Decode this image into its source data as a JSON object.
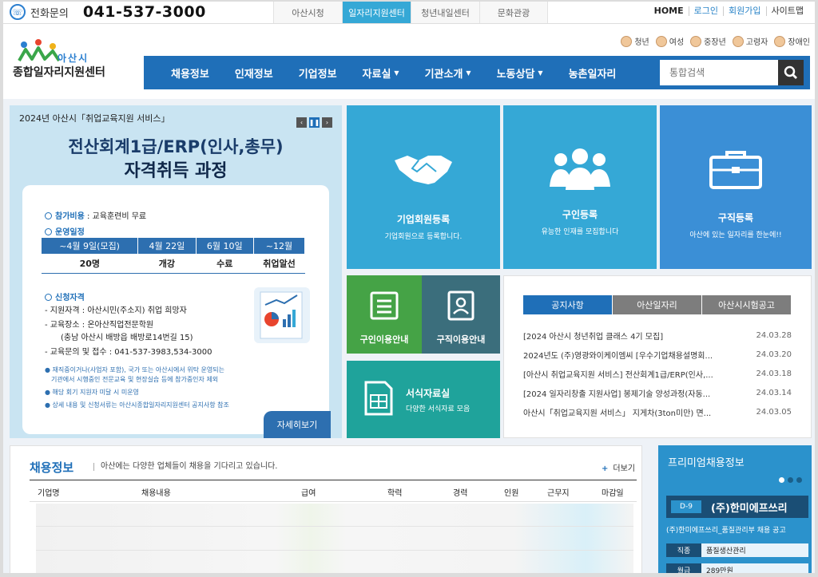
{
  "topbar": {
    "phone_label": "전화문의",
    "phone_number": "041-537-3000",
    "tabs": [
      "아산시청",
      "일자리지원센터",
      "청년내일센터",
      "문화관광"
    ],
    "links": [
      "HOME",
      "로그인",
      "회원가입",
      "사이트맵"
    ]
  },
  "header": {
    "logo_city": "아산시",
    "logo_title": "종합일자리지원센터",
    "user_types": [
      "청년",
      "여성",
      "중장년",
      "고령자",
      "장애인"
    ],
    "nav": [
      "채용정보",
      "인재정보",
      "기업정보",
      "자료실",
      "기관소개",
      "노동상담",
      "농촌일자리"
    ],
    "search_placeholder": "통합검색"
  },
  "banner": {
    "top": "2024년 아산시「취업교육지원 서비스」",
    "title1": "전산회계1급/ERP(인사,총무)",
    "title2": "자격취득 과정",
    "fee": "참가비용 : 교육훈련비 무료",
    "fee_label": "참가비용",
    "fee_value": "교육훈련비 무료",
    "schedule_heading": "운영일정",
    "schedule": {
      "headers": [
        "~4월 9일(모집)",
        "4월 22일",
        "6월 10일",
        "~12월"
      ],
      "values": [
        "20명",
        "개강",
        "수료",
        "취업알선"
      ]
    },
    "apply_heading": "신청자격",
    "apply_lines": [
      "- 지원자격 : 아산시민(주소지) 취업 희망자",
      "- 교육장소 : 온아산직업전문학원",
      "(충남 아산시 배방읍 배방로14번길 15)",
      "- 교육문의 및 접수 : 041-537-3983,534-3000"
    ],
    "notes": [
      "● 재직중이거나(사업자 포함), 국가 또는 아산시에서 위탁 운영되는",
      "기관에서 시행중인 전문교육 및 현장실습 등에 참가중인자 제외",
      "● 해당 회기 지원자 미달 시 미운영",
      "● 상세 내용 및 신청서류는 아산시종합일자리지원센터 공지사항 참조"
    ],
    "more": "자세히보기"
  },
  "tiles": {
    "t1": {
      "title": "기업회원등록",
      "sub": "기업회원으로 등록합니다."
    },
    "t2": {
      "title": "구인등록",
      "sub": "유능한 인재를 모집합니다"
    },
    "t3": {
      "title": "구직등록",
      "sub": "아산에 있는 일자리를 한눈에!!"
    },
    "t4": {
      "title": "구인이용안내"
    },
    "t5": {
      "title": "구직이용안내"
    },
    "t6": {
      "title": "서식자료실",
      "sub": "다양한 서식자료 모음"
    }
  },
  "notice": {
    "tabs": [
      "공지사항",
      "아산일자리",
      "아산시시험공고"
    ],
    "items": [
      {
        "title": "[2024 아산시 청년취업 클래스 4기 모집]",
        "date": "24.03.28"
      },
      {
        "title": "2024년도 (주)영광와이케이엠씨 [우수기업채용설명회...",
        "date": "24.03.20"
      },
      {
        "title": "[아산시 취업교육지원 서비스] 전산회계1급/ERP(인사,...",
        "date": "24.03.18"
      },
      {
        "title": "[2024 일자리창출 지원사업] 봉제기술 양성과정(자동...",
        "date": "24.03.14"
      },
      {
        "title": "아산시「취업교육지원 서비스」 지게차(3ton미만) 면...",
        "date": "24.03.05"
      }
    ]
  },
  "jobs": {
    "title": "채용정보",
    "desc": "아산에는 다양한 업체들이 채용을 기다리고 있습니다.",
    "more": "더보기",
    "columns": [
      "기업명",
      "채용내용",
      "급여",
      "학력",
      "경력",
      "인원",
      "근무지",
      "마감일"
    ]
  },
  "premium": {
    "title": "프리미엄채용정보",
    "dday": "D-9",
    "company": "(주)한미에프쓰리",
    "desc": "(주)한미에프쓰리_품질관리부 채용 공고",
    "fields": [
      {
        "k": "직종",
        "v": "품질생산관리"
      },
      {
        "k": "월급",
        "v": "289만원"
      }
    ]
  },
  "colors": {
    "brand": "#1f6fb8",
    "accent": "#35a8d6",
    "green": "#45a346",
    "teal": "#1fa39b"
  }
}
